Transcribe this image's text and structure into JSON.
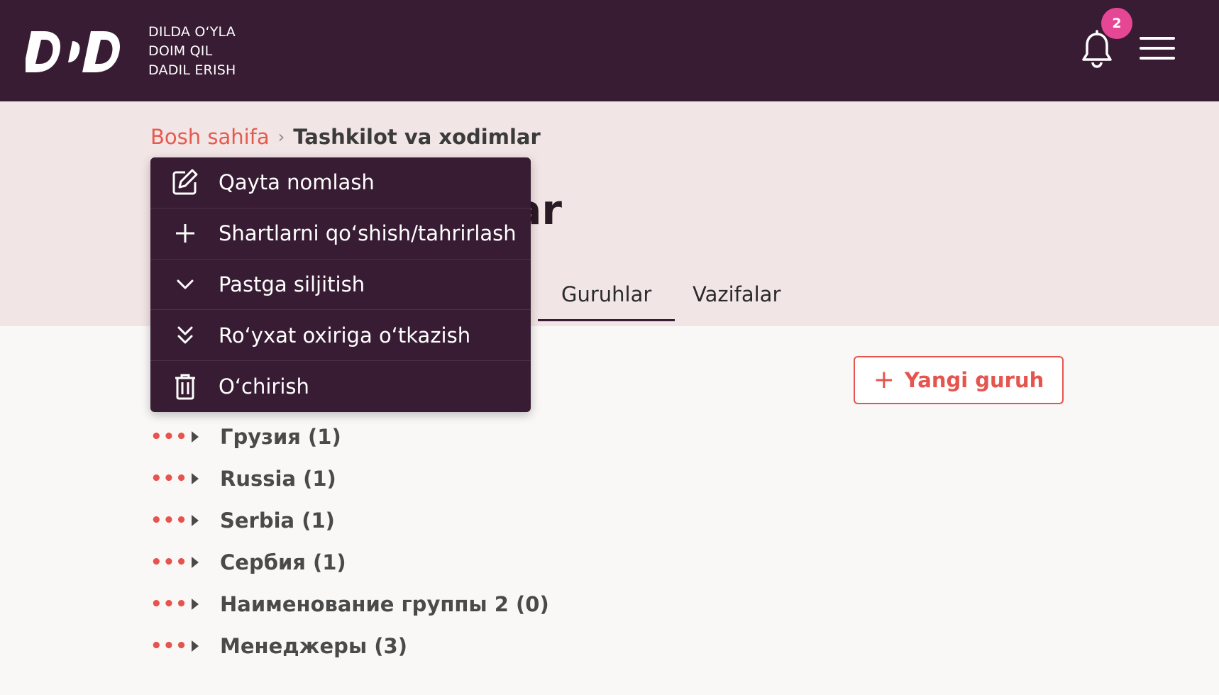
{
  "header": {
    "slogan": [
      "DILDA O‘YLA",
      "DOIM QIL",
      "DADIL ERISH"
    ],
    "notification_count": "2"
  },
  "breadcrumb": {
    "home": "Bosh sahifa",
    "current": "Tashkilot va xodimlar"
  },
  "page": {
    "title_visible_fragment": "ar"
  },
  "tabs": [
    {
      "label": "Guruhlar",
      "active": true
    },
    {
      "label": "Vazifalar",
      "active": false
    }
  ],
  "actions": {
    "new_group": "Yangi guruh"
  },
  "context_menu": {
    "items": [
      {
        "label": "Qayta nomlash",
        "icon": "edit-icon"
      },
      {
        "label": "Shartlarni qo‘shish/tahrirlash",
        "icon": "plus-icon"
      },
      {
        "label": "Pastga siljitish",
        "icon": "chevron-down-icon"
      },
      {
        "label": "Ro‘yxat oxiriga o‘tkazish",
        "icon": "double-chevron-down-icon"
      },
      {
        "label": "O‘chirish",
        "icon": "trash-icon"
      }
    ]
  },
  "groups": [
    {
      "label": "Грузия (1)"
    },
    {
      "label": "Russia (1)"
    },
    {
      "label": "Serbia (1)"
    },
    {
      "label": "Сербия (1)"
    },
    {
      "label": "Наименование группы 2 (0)"
    },
    {
      "label": "Менеджеры (3)"
    }
  ],
  "colors": {
    "header_bg": "#381c33",
    "hero_bg": "#f2e5e5",
    "accent": "#e5544d",
    "badge": "#e64795"
  }
}
